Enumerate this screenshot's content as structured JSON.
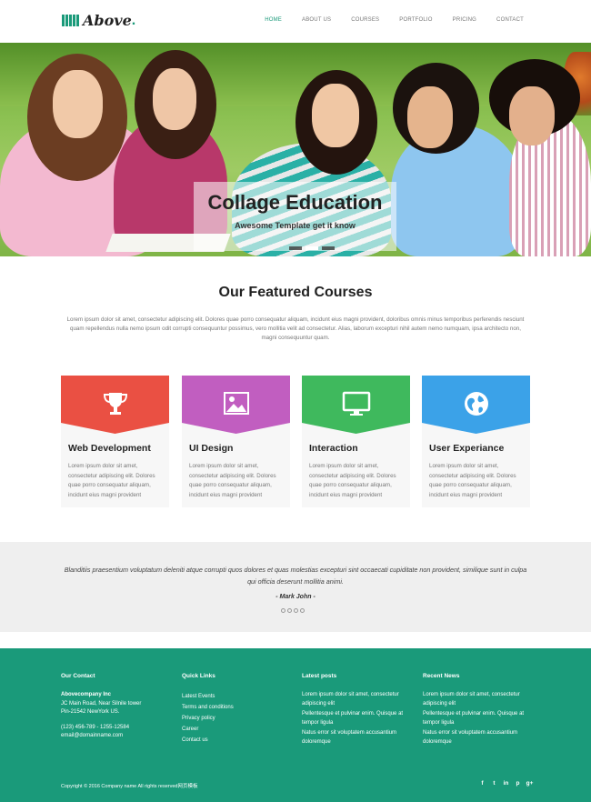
{
  "header": {
    "logo_text": "Above",
    "logo_dot": ".",
    "nav": [
      {
        "label": "HOME",
        "active": true
      },
      {
        "label": "ABOUT US",
        "active": false
      },
      {
        "label": "COURSES",
        "active": false
      },
      {
        "label": "PORTFOLIO",
        "active": false
      },
      {
        "label": "PRICING",
        "active": false
      },
      {
        "label": "CONTACT",
        "active": false
      }
    ]
  },
  "hero": {
    "title": "Collage Education",
    "subtitle": "Awesome Template get it know",
    "slide_count": 3,
    "active_slide": 2
  },
  "featured": {
    "title": "Our Featured Courses",
    "text": "Lorem ipsum dolor sit amet, consectetur adipiscing elit. Dolores quae porro consequatur aliquam, incidunt eius magni provident, doloribus omnis minus temporibus perferendis nesciunt quam repellendus nulla nemo ipsum odit corrupti consequuntur possimus, vero mollitia velit ad consectetur. Alias, laborum excepturi nihil autem nemo numquam, ipsa architecto non, magni consequuntur quam.",
    "cards": [
      {
        "title": "Web Development",
        "icon": "trophy-icon",
        "color": "#ea5043",
        "text": "Lorem ipsum dolor sit amet, consectetur adipiscing elit. Dolores quae porro consequatur aliquam, incidunt eius magni provident"
      },
      {
        "title": "UI Design",
        "icon": "picture-icon",
        "color": "#c15ec0",
        "text": "Lorem ipsum dolor sit amet, consectetur adipiscing elit. Dolores quae porro consequatur aliquam, incidunt eius magni provident"
      },
      {
        "title": "Interaction",
        "icon": "monitor-icon",
        "color": "#3fb95d",
        "text": "Lorem ipsum dolor sit amet, consectetur adipiscing elit. Dolores quae porro consequatur aliquam, incidunt eius magni provident"
      },
      {
        "title": "User Experiance",
        "icon": "globe-icon",
        "color": "#3ba2e8",
        "text": "Lorem ipsum dolor sit amet, consectetur adipiscing elit. Dolores quae porro consequatur aliquam, incidunt eius magni provident"
      }
    ]
  },
  "testimonial": {
    "quote": "Blanditiis praesentium voluptatum deleniti atque corrupti quos dolores et quas molestias excepturi sint occaecati cupiditate non provident, similique sunt in culpa qui officia deserunt mollitia animi.",
    "author": "- Mark John -",
    "dot_count": 4
  },
  "footer": {
    "contact": {
      "heading": "Our Contact",
      "company": "Abovecompany Inc",
      "address1": "JC Main Road, Near Silnile tower",
      "address2": "Pin-21542 NewYork US.",
      "phone": "(123) 456-789 - 1255-12584",
      "email": "email@domainname.com"
    },
    "quick_links": {
      "heading": "Quick Links",
      "items": [
        "Latest Events",
        "Terms and conditions",
        "Privacy policy",
        "Career",
        "Contact us"
      ]
    },
    "latest_posts": {
      "heading": "Latest posts",
      "items": [
        "Lorem ipsum dolor sit amet, consectetur adipiscing elit",
        "Pellentesque et pulvinar enim. Quisque at tempor ligula",
        "Natus error sit voluptatem accusantium doloremque"
      ]
    },
    "recent_news": {
      "heading": "Recent News",
      "items": [
        "Lorem ipsum dolor sit amet, consectetur adipiscing elit",
        "Pellentesque et pulvinar enim. Quisque at tempor ligula",
        "Natus error sit voluptatem accusantium doloremque"
      ]
    },
    "copyright": "Copyright © 2016 Company name All rights reserved网页模板",
    "social": [
      {
        "icon": "facebook-icon",
        "glyph": "f"
      },
      {
        "icon": "twitter-icon",
        "glyph": "t"
      },
      {
        "icon": "linkedin-icon",
        "glyph": "in"
      },
      {
        "icon": "pinterest-icon",
        "glyph": "p"
      },
      {
        "icon": "google-plus-icon",
        "glyph": "g+"
      }
    ]
  },
  "colors": {
    "accent": "#1a9a7a",
    "card_red": "#ea5043",
    "card_purple": "#c15ec0",
    "card_green": "#3fb95d",
    "card_blue": "#3ba2e8"
  }
}
